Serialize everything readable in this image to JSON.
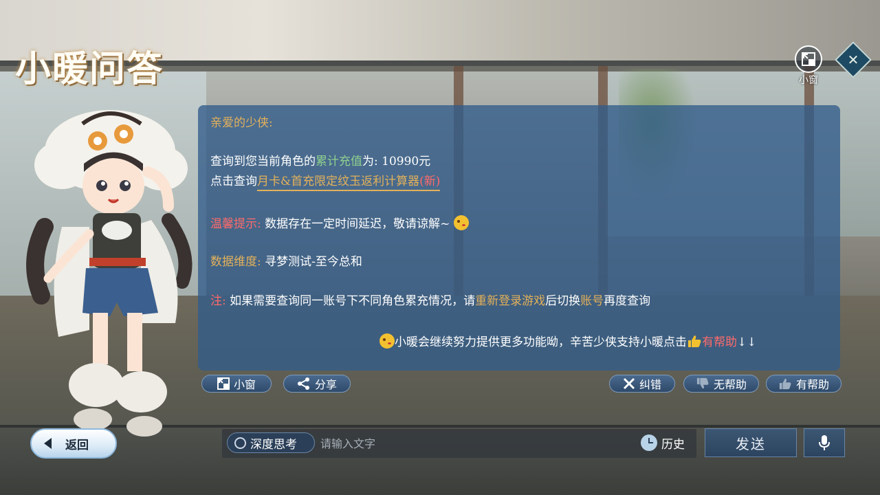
{
  "app": {
    "title": "小暖问答"
  },
  "top_right": {
    "mini_window_label": "小窗",
    "mini_window_icon": "mini-window-icon",
    "close_icon": "close-icon"
  },
  "answer": {
    "greeting": "亲爱的少侠:",
    "query_prefix": "查询到您当前角色的",
    "query_highlight": "累计充值",
    "query_suffix": "为: 10990元",
    "calc_prefix": "点击查询",
    "calc_link": "月卡&首充限定纹玉返利计算器",
    "calc_new": "(新)",
    "tip_label": "温馨提示:",
    "tip_text": " 数据存在一定时间延迟，敬请谅解~",
    "dim_label": "数据维度:",
    "dim_text": " 寻梦测试-至今总和",
    "note_label": "注:",
    "note_text_1": " 如果需要查询同一账号下不同角色累充情况，请",
    "note_highlight_1": "重新登录游戏",
    "note_text_2": "后切换",
    "note_highlight_2": "账号",
    "note_text_3": "再度查询",
    "footer_text": "小暖会继续努力提供更多功能呦，辛苦少侠支持小暖点击",
    "footer_helpful": "有帮助",
    "footer_arrows": "↓↓"
  },
  "actions": {
    "mini_window": "小窗",
    "share": "分享",
    "correct": "纠错",
    "not_helpful": "无帮助",
    "helpful": "有帮助"
  },
  "bottom": {
    "back": "返回",
    "deep_think": "深度思考",
    "input_placeholder": "请输入文字",
    "history": "历史",
    "send": "发送"
  },
  "colors": {
    "panel_bg": "#325c8a",
    "gold": "#e3b15b",
    "green": "#8fd08e",
    "red": "#ff6b6b"
  }
}
